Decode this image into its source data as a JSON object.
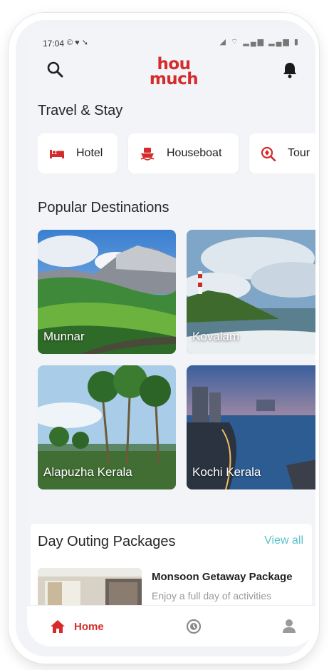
{
  "status_bar": {
    "time": "17:04",
    "left_icons": "© ♥ ➘",
    "right_icons": "◢ ⌔ ▂▄▆ ▂▄▆ ▮"
  },
  "header": {
    "logo_line1": "hou",
    "logo_line2": "much",
    "search_icon": "search-icon",
    "bell_icon": "bell-icon"
  },
  "travel_section": {
    "title": "Travel & Stay",
    "categories": [
      {
        "label": "Hotel",
        "icon": "bed-icon"
      },
      {
        "label": "Houseboat",
        "icon": "boat-icon"
      },
      {
        "label": "Tour",
        "icon": "tour-icon"
      }
    ]
  },
  "destinations_section": {
    "title": "Popular Destinations",
    "items": [
      {
        "label": "Munnar"
      },
      {
        "label": "Kovalam"
      },
      {
        "label": "Alapuzha Kerala"
      },
      {
        "label": "Kochi Kerala"
      }
    ]
  },
  "packages_section": {
    "title": "Day Outing Packages",
    "view_all": "View all",
    "items": [
      {
        "name": "Monsoon Getaway Package",
        "description": "Enjoy a full day of activities"
      }
    ]
  },
  "bottom_nav": {
    "home_label": "Home",
    "home_icon": "home-icon",
    "history_icon": "history-icon",
    "profile_icon": "profile-icon"
  },
  "colors": {
    "brand": "#d52b2b",
    "accent": "#5bc2c9",
    "background": "#f3f4f7"
  }
}
